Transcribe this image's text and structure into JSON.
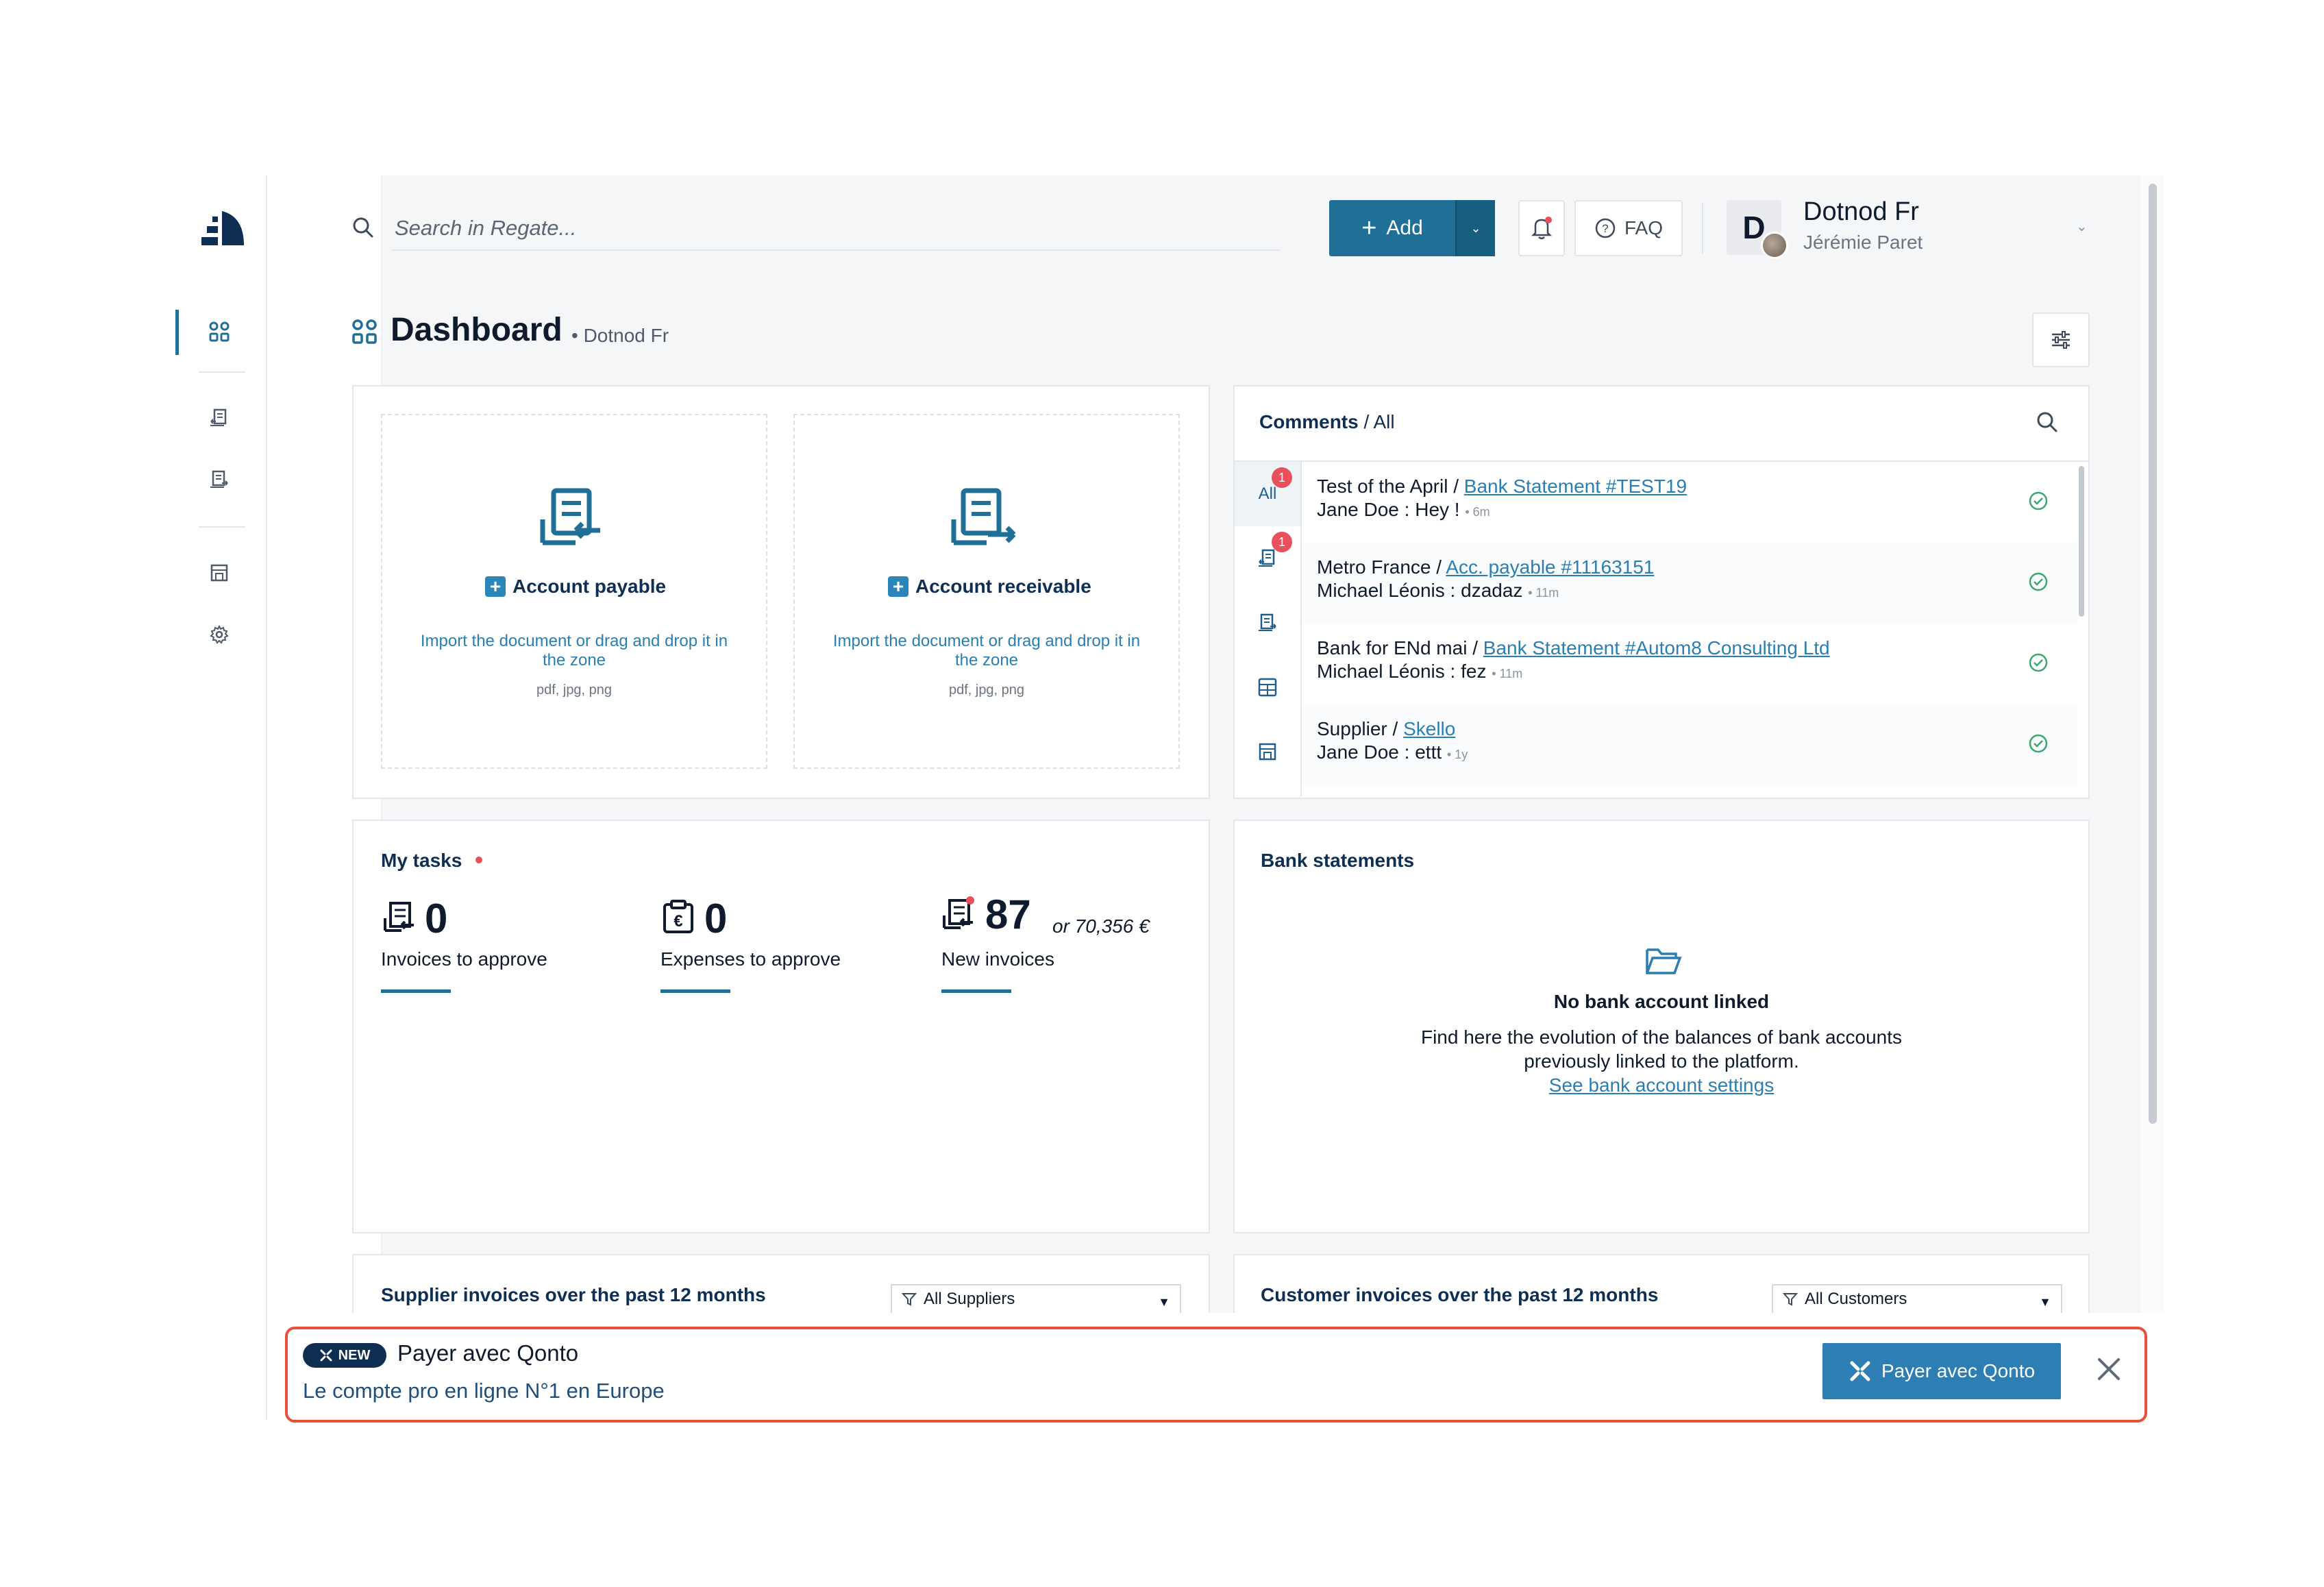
{
  "search": {
    "placeholder": "Search in Regate..."
  },
  "topbar": {
    "add_label": "Add",
    "faq_label": "FAQ",
    "user_initial": "D",
    "user_name": "Dotnod Fr",
    "user_sub": "Jérémie Paret"
  },
  "page": {
    "title": "Dashboard",
    "subtitle": "• Dotnod Fr"
  },
  "upload": {
    "payable": {
      "label": "Account payable",
      "desc": "Import the document or drag and drop it in the zone",
      "formats": "pdf, jpg, png"
    },
    "receivable": {
      "label": "Account receivable",
      "desc": "Import the document or drag and drop it in the zone",
      "formats": "pdf, jpg, png"
    }
  },
  "comments": {
    "title": "Comments",
    "filter": "/ All",
    "tabs": [
      {
        "label": "All",
        "badge": "1"
      },
      {
        "label": "",
        "badge": "1"
      }
    ],
    "items": [
      {
        "context": "Test of the April",
        "link": "Bank Statement #TEST19",
        "author": "Jane Doe",
        "message": "Hey !",
        "time": "6m"
      },
      {
        "context": "Metro France",
        "link": "Acc. payable #11163151",
        "author": "Michael Léonis",
        "message": "dzadaz",
        "time": "11m"
      },
      {
        "context": "Bank for ENd mai",
        "link": "Bank Statement #Autom8 Consulting Ltd",
        "author": "Michael Léonis",
        "message": "fez",
        "time": "11m"
      },
      {
        "context": "Supplier",
        "link": "Skello",
        "author": "Jane Doe",
        "message": "ettt",
        "time": "1y"
      }
    ]
  },
  "tasks": {
    "title": "My tasks",
    "items": [
      {
        "count": "0",
        "label": "Invoices to approve",
        "extra": ""
      },
      {
        "count": "0",
        "label": "Expenses to approve",
        "extra": ""
      },
      {
        "count": "87",
        "label": "New invoices",
        "extra": "or 70,356 €"
      }
    ]
  },
  "bank": {
    "title": "Bank statements",
    "empty_title": "No bank account linked",
    "empty_desc_1": "Find here the evolution of the balances of bank accounts",
    "empty_desc_2": "previously linked to the platform.",
    "link": "See bank account settings"
  },
  "supplier_chart": {
    "title": "Supplier invoices over the past 12 months",
    "filter": "All Suppliers"
  },
  "customer_chart": {
    "title": "Customer invoices over the past 12 months",
    "filter": "All Customers"
  },
  "banner": {
    "badge": "NEW",
    "title": "Payer avec Qonto",
    "subtitle": "Le compte pro en ligne N°1 en Europe",
    "button": "Payer avec Qonto"
  },
  "colors": {
    "primary": "#1f6f97",
    "link": "#2a7fb0",
    "navy": "#0f2f52",
    "alert": "#e8505b",
    "banner_border": "#e8503a",
    "success": "#3aa76d"
  }
}
